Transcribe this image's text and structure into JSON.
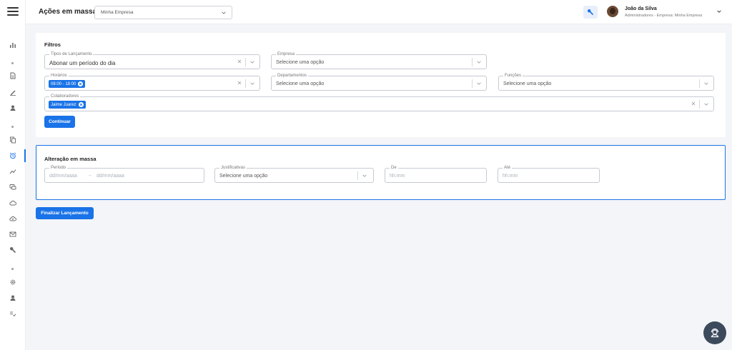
{
  "header": {
    "title": "Ações em massa",
    "company_select": {
      "value": "Minha Empresa"
    },
    "user": {
      "name": "João da Silva",
      "subtitle": "Administradores - Empresa: Minha Empresa"
    }
  },
  "filters": {
    "title": "Filtros",
    "tipos_lancamento": {
      "label": "Tipos de Lançamento",
      "value": "Abonar um período do dia"
    },
    "empresa": {
      "label": "Empresa",
      "placeholder": "Selecione uma opção"
    },
    "horarios": {
      "label": "Horários",
      "chips": [
        "08:00 - 18:00"
      ]
    },
    "departamentos": {
      "label": "Departamentos",
      "placeholder": "Selecione uma opção"
    },
    "funcoes": {
      "label": "Funções",
      "placeholder": "Selecione uma opção"
    },
    "colaboradores": {
      "label": "Colaboradores",
      "chips": [
        "Jaime Juarez"
      ]
    },
    "continue_label": "Continuar"
  },
  "mass_change": {
    "title": "Alteração em massa",
    "periodo": {
      "label": "Período",
      "start_placeholder": "dd/mm/aaaa",
      "arrow": "→",
      "end_placeholder": "dd/mm/aaaa"
    },
    "justificativas": {
      "label": "Justificativas",
      "placeholder": "Selecione uma opção"
    },
    "de": {
      "label": "De",
      "placeholder": "hh:mm"
    },
    "ate": {
      "label": "Até",
      "placeholder": "hh:mm"
    }
  },
  "finalize_label": "Finalizar Lançamento",
  "colors": {
    "primary": "#1a73e8",
    "fab": "#3c4a5c"
  }
}
